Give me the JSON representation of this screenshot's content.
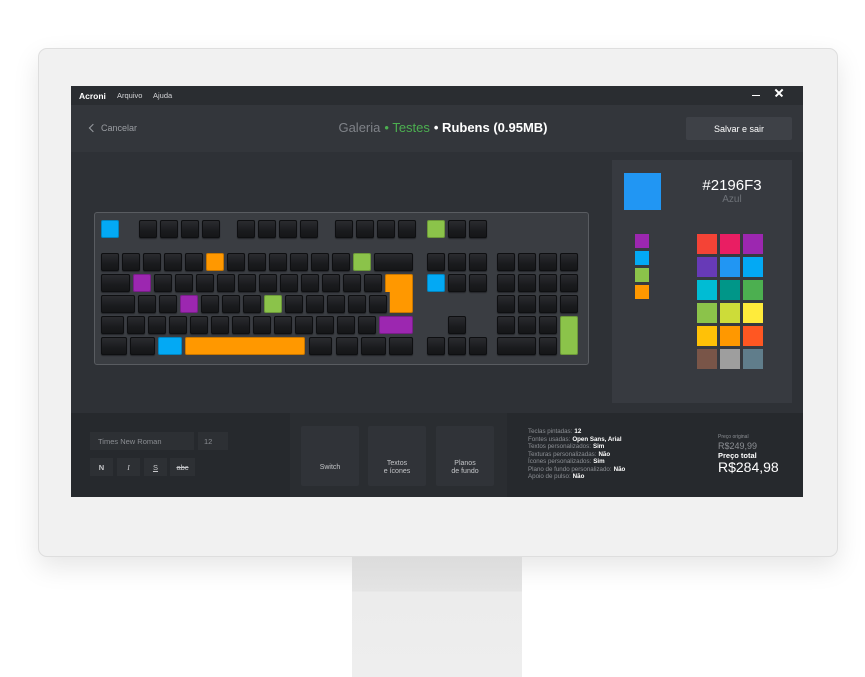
{
  "app": {
    "name": "Acroni",
    "menu": [
      "Arquivo",
      "Ajuda"
    ]
  },
  "window_controls": {
    "minimize_icon": "minimize-icon",
    "close_icon": "close-icon"
  },
  "header": {
    "cancel_icon": "chevron-left-icon",
    "cancel_label": "Cancelar",
    "breadcrumb": {
      "gallery": "Galeria",
      "collection": "• Testes",
      "item": "• Rubens (0.95MB)"
    },
    "save_label": "Salvar e sair"
  },
  "color_picker": {
    "selected": {
      "hex": "#2196F3",
      "name": "Azul"
    },
    "recent": [
      "#9C27B0",
      "#03A9F4",
      "#8BC34A",
      "#FF9800"
    ],
    "palette": [
      "#F44336",
      "#E91E63",
      "#9C27B0",
      "#673AB7",
      "#2196F3",
      "#03A9F4",
      "#00BCD4",
      "#009688",
      "#4CAF50",
      "#8BC34A",
      "#CDDC39",
      "#FFEB3B",
      "#FFC107",
      "#FF9800",
      "#FF5722",
      "#795548",
      "#9E9E9E",
      "#607D8B"
    ]
  },
  "keyboard": {
    "painted_keys": {
      "esc": "#03A9F4",
      "prtsc": "#8BC34A",
      "n5": "#FF9800",
      "equal": "#8BC34A",
      "q": "#9C27B0",
      "enter": "#FF9800",
      "del": "#03A9F4",
      "d": "#9C27B0",
      "j": "#8BC34A",
      "rshift": "#9C27B0",
      "lalt": "#03A9F4",
      "space": "#FF9800",
      "kpenter": "#8BC34A"
    }
  },
  "text_tools": {
    "font": "Times New Roman",
    "size": "12",
    "bold": "N",
    "italic": "I",
    "underline": "S",
    "strike": "abc"
  },
  "tools": [
    {
      "label_lines": [
        "Switch"
      ]
    },
    {
      "label_lines": [
        "Textos",
        "e ícones"
      ]
    },
    {
      "label_lines": [
        "Planos",
        "de fundo"
      ]
    }
  ],
  "summary": [
    {
      "label": "Teclas pintadas:",
      "value": "12"
    },
    {
      "label": "Fontes usadas:",
      "value": "Open Sans, Arial"
    },
    {
      "label": "Textos personalizados:",
      "value": "Sim"
    },
    {
      "label": "Texturas personalizadas:",
      "value": "Não"
    },
    {
      "label": "Ícones personalizados:",
      "value": "Sim"
    },
    {
      "label": "Plano de fundo personalizado:",
      "value": "Não"
    },
    {
      "label": "Apoio de pulso:",
      "value": "Não"
    }
  ],
  "price": {
    "original_label": "Preço original",
    "original": "R$249,99",
    "total_label": "Preço total",
    "total": "R$284,98"
  }
}
